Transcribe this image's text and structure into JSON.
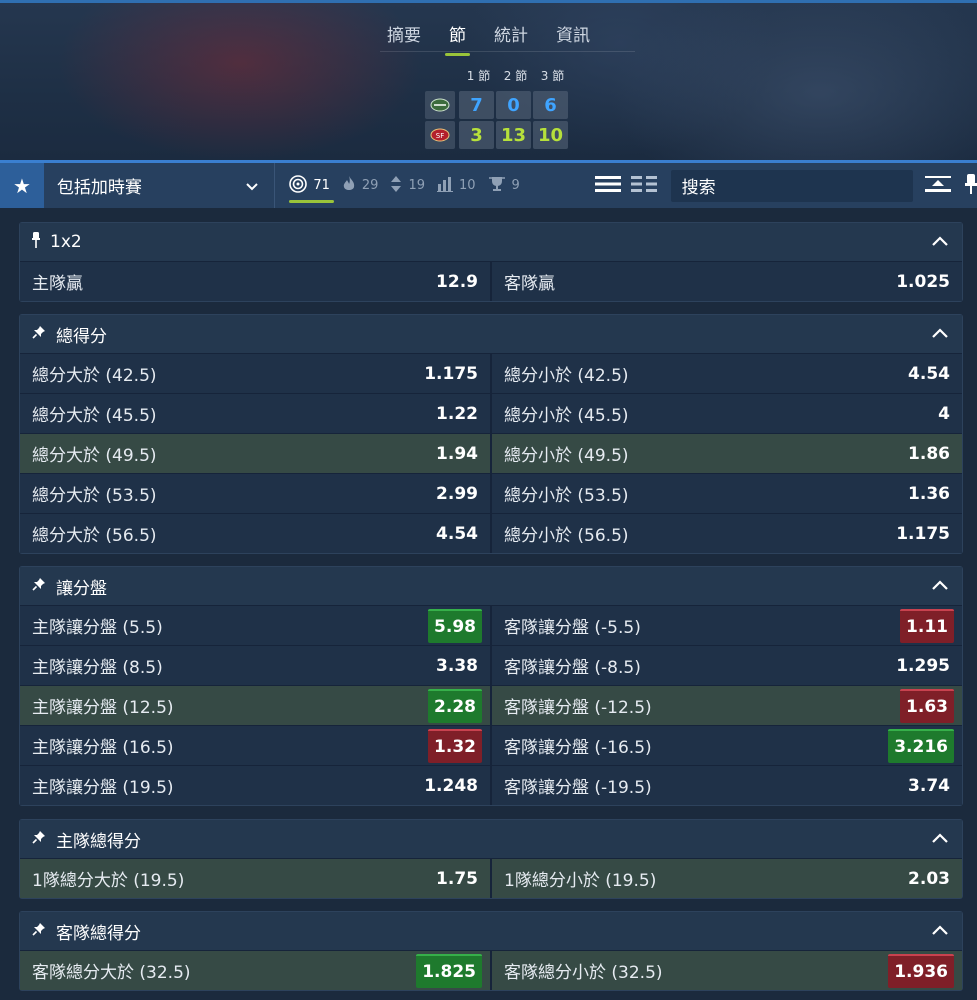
{
  "tabs": [
    {
      "label": "摘要",
      "active": false
    },
    {
      "label": "節",
      "active": true
    },
    {
      "label": "統計",
      "active": false
    },
    {
      "label": "資訊",
      "active": false
    }
  ],
  "score": {
    "headers": [
      "1 節",
      "2 節",
      "3 節"
    ],
    "teams": [
      {
        "logo_icon": "jets-logo-icon",
        "scores": [
          "7",
          "0",
          "6"
        ],
        "color": "#3fa4ff"
      },
      {
        "logo_icon": "49ers-logo-icon",
        "scores": [
          "3",
          "13",
          "10"
        ],
        "color": "#b6e03b"
      }
    ]
  },
  "toolbar": {
    "select_label": "包括加時賽",
    "filters": [
      {
        "icon": "target-icon",
        "count": "71",
        "active": true
      },
      {
        "icon": "fire-icon",
        "count": "29",
        "active": false
      },
      {
        "icon": "updown-arrows-icon",
        "count": "19",
        "active": false
      },
      {
        "icon": "bar-chart-icon",
        "count": "10",
        "active": false
      },
      {
        "icon": "trophy-icon",
        "count": "9",
        "active": false
      }
    ],
    "search_placeholder": "搜索"
  },
  "markets": [
    {
      "title": "1x2",
      "icon": "pin-vertical-icon",
      "rows": [
        {
          "highlight": false,
          "left": {
            "label": "主隊贏",
            "odd": "12.9",
            "trend": ""
          },
          "right": {
            "label": "客隊贏",
            "odd": "1.025",
            "trend": ""
          }
        }
      ]
    },
    {
      "title": "總得分",
      "icon": "pin-icon",
      "rows": [
        {
          "highlight": false,
          "left": {
            "label": "總分大於 (42.5)",
            "odd": "1.175",
            "trend": ""
          },
          "right": {
            "label": "總分小於 (42.5)",
            "odd": "4.54",
            "trend": ""
          }
        },
        {
          "highlight": false,
          "left": {
            "label": "總分大於 (45.5)",
            "odd": "1.22",
            "trend": ""
          },
          "right": {
            "label": "總分小於 (45.5)",
            "odd": "4",
            "trend": ""
          }
        },
        {
          "highlight": true,
          "left": {
            "label": "總分大於 (49.5)",
            "odd": "1.94",
            "trend": ""
          },
          "right": {
            "label": "總分小於 (49.5)",
            "odd": "1.86",
            "trend": ""
          }
        },
        {
          "highlight": false,
          "left": {
            "label": "總分大於 (53.5)",
            "odd": "2.99",
            "trend": ""
          },
          "right": {
            "label": "總分小於 (53.5)",
            "odd": "1.36",
            "trend": ""
          }
        },
        {
          "highlight": false,
          "left": {
            "label": "總分大於 (56.5)",
            "odd": "4.54",
            "trend": ""
          },
          "right": {
            "label": "總分小於 (56.5)",
            "odd": "1.175",
            "trend": ""
          }
        }
      ]
    },
    {
      "title": "讓分盤",
      "icon": "pin-icon",
      "rows": [
        {
          "highlight": false,
          "left": {
            "label": "主隊讓分盤 (5.5)",
            "odd": "5.98",
            "trend": "up"
          },
          "right": {
            "label": "客隊讓分盤 (-5.5)",
            "odd": "1.11",
            "trend": "down"
          }
        },
        {
          "highlight": false,
          "left": {
            "label": "主隊讓分盤 (8.5)",
            "odd": "3.38",
            "trend": ""
          },
          "right": {
            "label": "客隊讓分盤 (-8.5)",
            "odd": "1.295",
            "trend": ""
          }
        },
        {
          "highlight": true,
          "left": {
            "label": "主隊讓分盤 (12.5)",
            "odd": "2.28",
            "trend": "up"
          },
          "right": {
            "label": "客隊讓分盤 (-12.5)",
            "odd": "1.63",
            "trend": "down"
          }
        },
        {
          "highlight": false,
          "left": {
            "label": "主隊讓分盤 (16.5)",
            "odd": "1.32",
            "trend": "down"
          },
          "right": {
            "label": "客隊讓分盤 (-16.5)",
            "odd": "3.216",
            "trend": "up"
          }
        },
        {
          "highlight": false,
          "left": {
            "label": "主隊讓分盤 (19.5)",
            "odd": "1.248",
            "trend": ""
          },
          "right": {
            "label": "客隊讓分盤 (-19.5)",
            "odd": "3.74",
            "trend": ""
          }
        }
      ]
    },
    {
      "title": "主隊總得分",
      "icon": "pin-icon",
      "rows": [
        {
          "highlight": true,
          "left": {
            "label": "1隊總分大於 (19.5)",
            "odd": "1.75",
            "trend": ""
          },
          "right": {
            "label": "1隊總分小於 (19.5)",
            "odd": "2.03",
            "trend": ""
          }
        }
      ]
    },
    {
      "title": "客隊總得分",
      "icon": "pin-icon",
      "rows": [
        {
          "highlight": true,
          "left": {
            "label": "客隊總分大於 (32.5)",
            "odd": "1.825",
            "trend": "up"
          },
          "right": {
            "label": "客隊總分小於 (32.5)",
            "odd": "1.936",
            "trend": "down"
          }
        }
      ]
    }
  ]
}
